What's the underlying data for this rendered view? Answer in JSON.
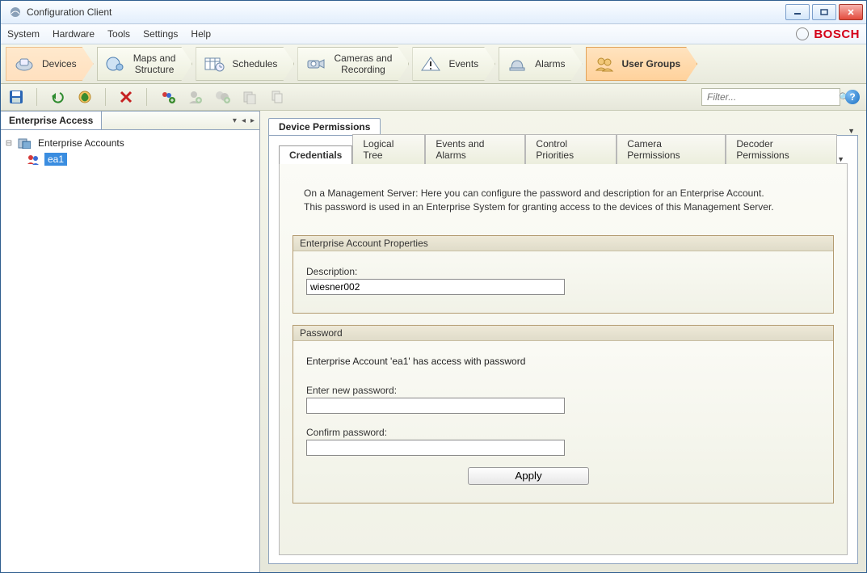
{
  "window": {
    "title": "Configuration Client"
  },
  "menu": {
    "items": [
      "System",
      "Hardware",
      "Tools",
      "Settings",
      "Help"
    ],
    "brand": "BOSCH"
  },
  "nav": {
    "items": [
      {
        "label": "Devices"
      },
      {
        "label": "Maps and\nStructure"
      },
      {
        "label": "Schedules"
      },
      {
        "label": "Cameras and\nRecording"
      },
      {
        "label": "Events"
      },
      {
        "label": "Alarms"
      },
      {
        "label": "User Groups"
      }
    ]
  },
  "toolbar": {
    "filter_placeholder": "Filter..."
  },
  "left": {
    "title": "Enterprise Access",
    "root": "Enterprise Accounts",
    "child": "ea1"
  },
  "perm": {
    "section": "Device Permissions",
    "tabs": [
      "Credentials",
      "Logical Tree",
      "Events and Alarms",
      "Control Priorities",
      "Camera Permissions",
      "Decoder Permissions"
    ],
    "info1": "On a Management Server: Here you can configure the password and description for an Enterprise Account.",
    "info2": "This password is used in an Enterprise System for granting access to the devices of this Management Server.",
    "group1_title": "Enterprise Account Properties",
    "desc_label": "Description:",
    "desc_value": "wiesner002",
    "group2_title": "Password",
    "pw_status": "Enterprise Account 'ea1' has access with password",
    "pw_new_label": "Enter new password:",
    "pw_confirm_label": "Confirm password:",
    "apply": "Apply"
  }
}
